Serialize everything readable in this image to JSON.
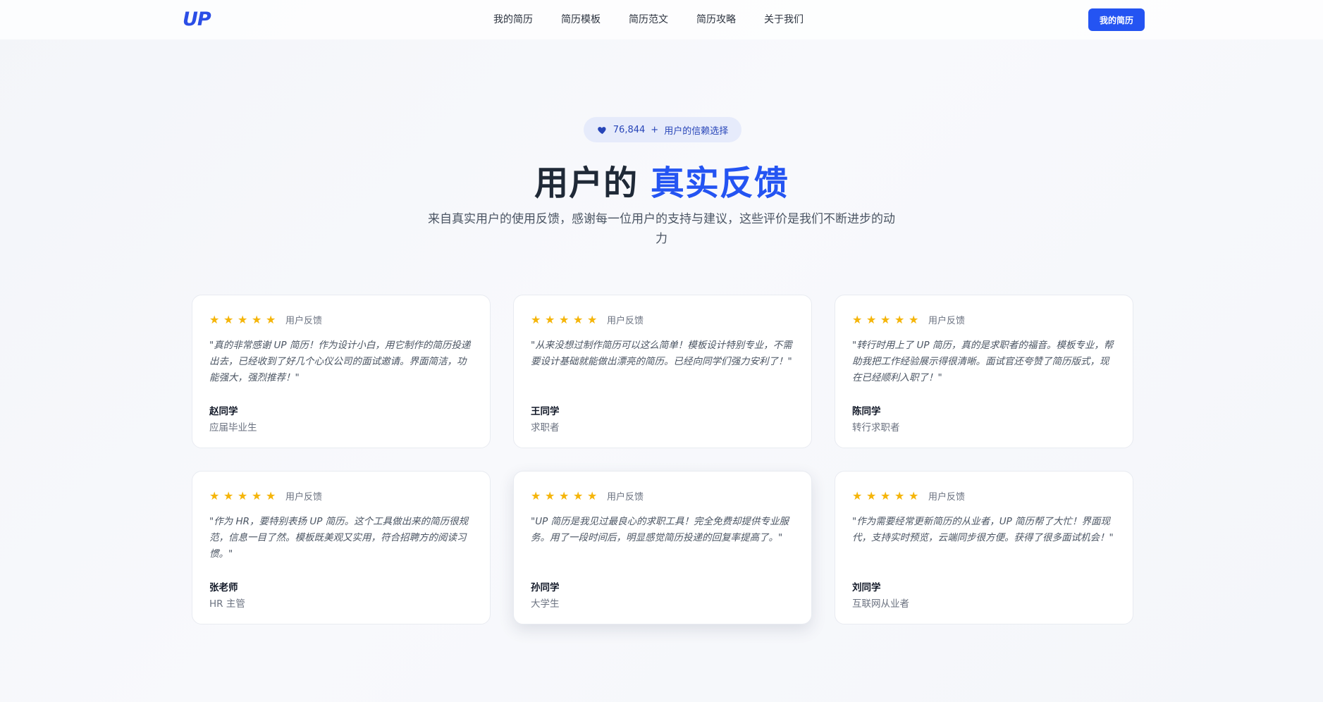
{
  "header": {
    "logo": "UP",
    "nav": [
      {
        "label": "我的简历"
      },
      {
        "label": "简历模板"
      },
      {
        "label": "简历范文"
      },
      {
        "label": "简历攻略"
      },
      {
        "label": "关于我们"
      }
    ],
    "cta_label": "我的简历"
  },
  "badge": {
    "count": "76,844",
    "plus": "+",
    "text": "用户的信赖选择",
    "icon": "heart-icon"
  },
  "hero": {
    "title_plain": "用户的",
    "title_accent": "真实反馈",
    "subtitle": "来自真实用户的使用反馈，感谢每一位用户的支持与建议，这些评价是我们不断进步的动力"
  },
  "colors": {
    "accent": "#2454f2",
    "star": "#f5b50a",
    "badge_bg": "#e6ebfb"
  },
  "testimonials": [
    {
      "rating": 5,
      "tag": "用户反馈",
      "quote": "\"真的非常感谢 UP 简历！作为设计小白，用它制作的简历投递出去，已经收到了好几个心仪公司的面试邀请。界面简洁，功能强大，强烈推荐！\"",
      "name": "赵同学",
      "role": "应届毕业生"
    },
    {
      "rating": 5,
      "tag": "用户反馈",
      "quote": "\"从来没想过制作简历可以这么简单！模板设计特别专业，不需要设计基础就能做出漂亮的简历。已经向同学们强力安利了！\"",
      "name": "王同学",
      "role": "求职者"
    },
    {
      "rating": 5,
      "tag": "用户反馈",
      "quote": "\"转行时用上了 UP 简历，真的是求职者的福音。模板专业，帮助我把工作经验展示得很清晰。面试官还夸赞了简历版式，现在已经顺利入职了！\"",
      "name": "陈同学",
      "role": "转行求职者"
    },
    {
      "rating": 5,
      "tag": "用户反馈",
      "quote": "\"作为 HR，要特别表扬 UP 简历。这个工具做出来的简历很规范，信息一目了然。模板既美观又实用，符合招聘方的阅读习惯。\"",
      "name": "张老师",
      "role": "HR 主管"
    },
    {
      "rating": 5,
      "tag": "用户反馈",
      "quote": "\"UP 简历是我见过最良心的求职工具！完全免费却提供专业服务。用了一段时间后，明显感觉简历投递的回复率提高了。\"",
      "name": "孙同学",
      "role": "大学生"
    },
    {
      "rating": 5,
      "tag": "用户反馈",
      "quote": "\"作为需要经常更新简历的从业者，UP 简历帮了大忙！界面现代，支持实时预览，云端同步很方便。获得了很多面试机会！\"",
      "name": "刘同学",
      "role": "互联网从业者"
    }
  ]
}
